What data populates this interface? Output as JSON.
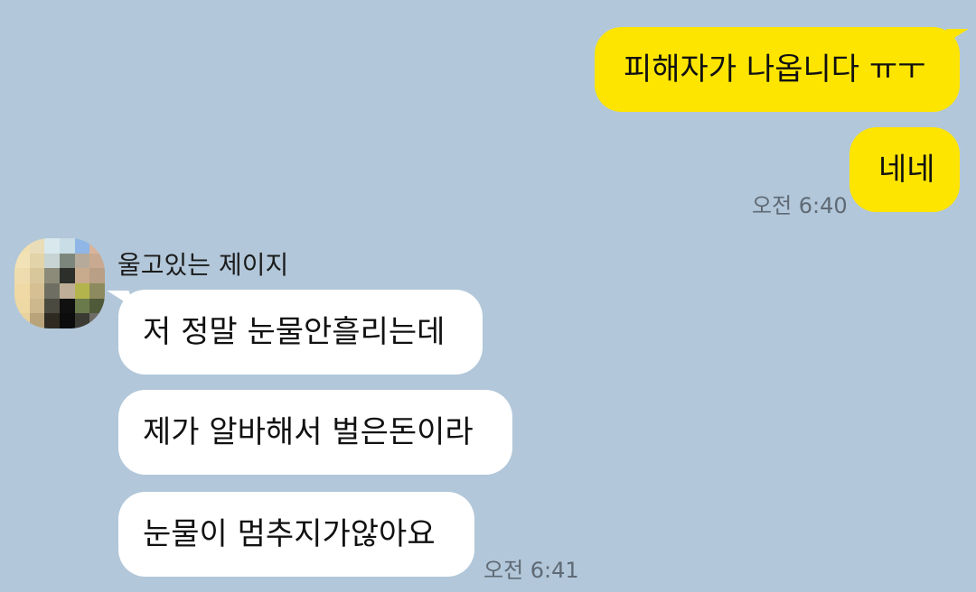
{
  "messages_out": [
    {
      "text": "피해자가 나옵니다 ㅠㅜ"
    },
    {
      "text": "네네",
      "time": "오전 6:40"
    }
  ],
  "sender": {
    "name": "울고있는 제이지",
    "avatar_icon": "pixelated-profile-photo"
  },
  "messages_in": [
    {
      "text": "저 정말 눈물안흘리는데"
    },
    {
      "text": "제가 알바해서 벌은돈이라"
    },
    {
      "text": "눈물이 멈추지가않아요",
      "time": "오전 6:41"
    }
  ],
  "colors": {
    "background": "#b2c7d9",
    "outgoing_bubble": "#fee500",
    "incoming_bubble": "#ffffff"
  }
}
